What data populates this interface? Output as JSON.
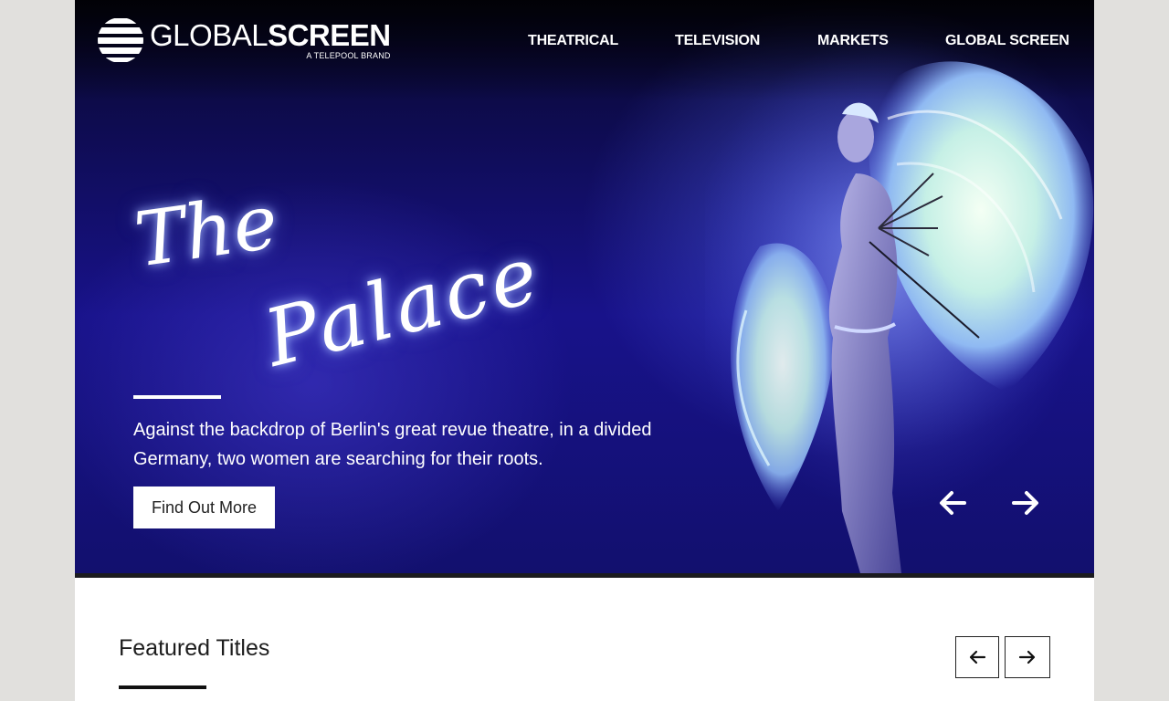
{
  "brand": {
    "name_light": "GLOBAL",
    "name_bold": "SCREEN",
    "tagline": "A TELEPOOL BRAND",
    "logo_icon": "globe-stripes-icon"
  },
  "nav": {
    "items": [
      "THEATRICAL",
      "TELEVISION",
      "MARKETS",
      "GLOBAL SCREEN"
    ]
  },
  "hero": {
    "title_line1": "The",
    "title_line2": "Palace",
    "description": "Against the backdrop of Berlin's great revue theatre, in a divided Germany, two women are searching for their roots.",
    "cta_label": "Find Out More",
    "prev_icon": "arrow-left-icon",
    "next_icon": "arrow-right-icon"
  },
  "featured": {
    "heading": "Featured Titles",
    "prev_icon": "arrow-left-icon",
    "next_icon": "arrow-right-icon"
  },
  "colors": {
    "hero_deep": "#0d0b4a",
    "hero_mid": "#18128a",
    "page_bg": "#e1e0dd",
    "text_dark": "#1d1d1d"
  }
}
